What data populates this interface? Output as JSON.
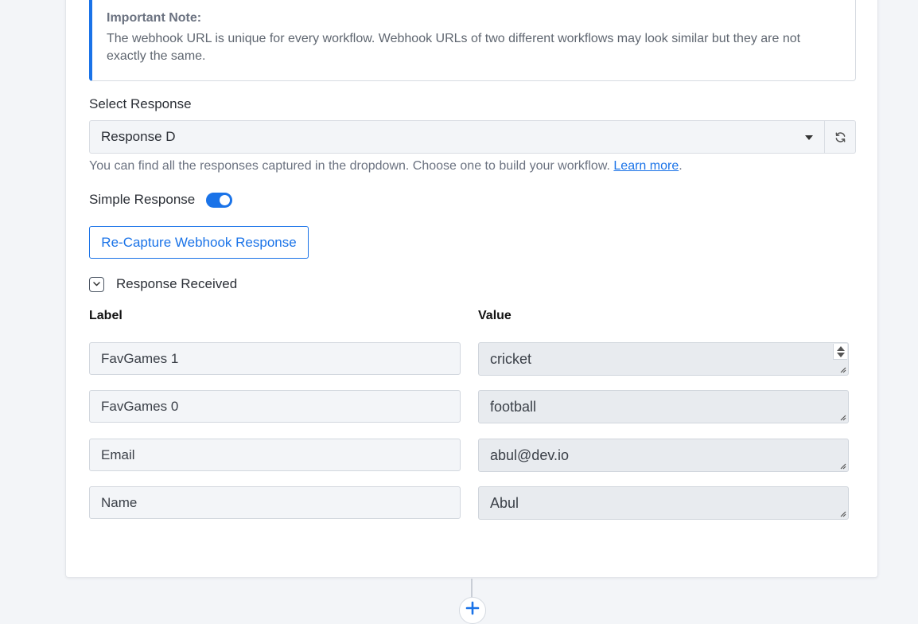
{
  "note": {
    "title": "Important Note:",
    "text": "The webhook URL is unique for every workflow. Webhook URLs of two different workflows may look similar but they are not exactly the same."
  },
  "select_response": {
    "label": "Select Response",
    "selected": "Response D",
    "help_text": "You can find all the responses captured in the dropdown. Choose one to build your workflow.",
    "learn_more": "Learn more",
    "help_suffix": "."
  },
  "simple_response": {
    "label": "Simple Response",
    "enabled": true
  },
  "recapture_button": "Re-Capture Webhook Response",
  "response_received": {
    "label": "Response Received",
    "expanded": true
  },
  "table": {
    "label_header": "Label",
    "value_header": "Value",
    "rows": [
      {
        "label": "FavGames 1",
        "value": "cricket"
      },
      {
        "label": "FavGames 0",
        "value": "football"
      },
      {
        "label": "Email",
        "value": "abul@dev.io"
      },
      {
        "label": "Name",
        "value": "Abul"
      }
    ]
  },
  "colors": {
    "accent": "#1a73e8",
    "page_bg": "#f3f5f8"
  },
  "icons": {
    "refresh": "refresh-icon",
    "dropdown": "caret-down-icon",
    "collapse": "chevron-down-icon",
    "add": "plus-icon"
  }
}
